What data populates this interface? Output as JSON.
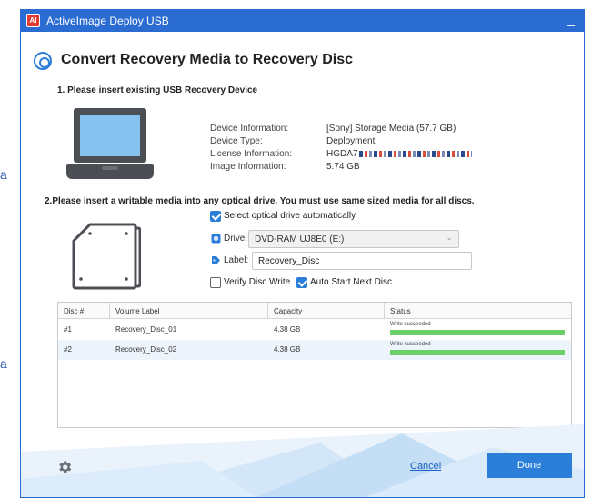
{
  "window": {
    "title": "ActiveImage Deploy USB",
    "logo_text": "AI",
    "minimize_label": "_"
  },
  "edge_text": "a",
  "header": {
    "title": "Convert Recovery Media to Recovery Disc",
    "icon": "disc-icon"
  },
  "step1": {
    "title": "1. Please insert existing USB Recovery Device",
    "device_icon": "laptop-icon",
    "info": [
      {
        "label": "Device Information:",
        "value": "[Sony] Storage Media (57.7 GB)"
      },
      {
        "label": "Device Type:",
        "value": "Deployment"
      },
      {
        "label": "License Information:",
        "value": "HGDA7"
      },
      {
        "label": "Image Information:",
        "value": "5.74 GB"
      }
    ]
  },
  "step2": {
    "title": "2.Please insert a writable media into any optical drive. You must use same sized media for all discs.",
    "device_icon": "optical-drive-icon",
    "auto_select": {
      "label": "Select optical drive automatically",
      "checked": true
    },
    "drive": {
      "label": "Drive:",
      "value": "DVD-RAM UJ8E0 (E:)",
      "icon": "drive-icon"
    },
    "disc_label": {
      "label": "Label:",
      "value": "Recovery_Disc",
      "icon": "tag-icon"
    },
    "verify": {
      "label": "Verify Disc Write",
      "checked": false
    },
    "auto_start": {
      "label": "Auto Start Next Disc",
      "checked": true
    }
  },
  "table": {
    "columns": [
      "Disc #",
      "Volume Label",
      "Capacity",
      "Status"
    ],
    "rows": [
      {
        "disc": "#1",
        "volume": "Recovery_Disc_01",
        "capacity": "4.38 GB",
        "status": "Write succeeded",
        "progress": 1.0
      },
      {
        "disc": "#2",
        "volume": "Recovery_Disc_02",
        "capacity": "4.38 GB",
        "status": "Write succeeded",
        "progress": 1.0
      }
    ]
  },
  "footer": {
    "settings_icon": "gear-icon",
    "cancel_label": "Cancel",
    "done_label": "Done"
  },
  "colors": {
    "accent": "#2b7fd9",
    "titlebar": "#2b6cd2",
    "progress": "#6ccf6a"
  }
}
